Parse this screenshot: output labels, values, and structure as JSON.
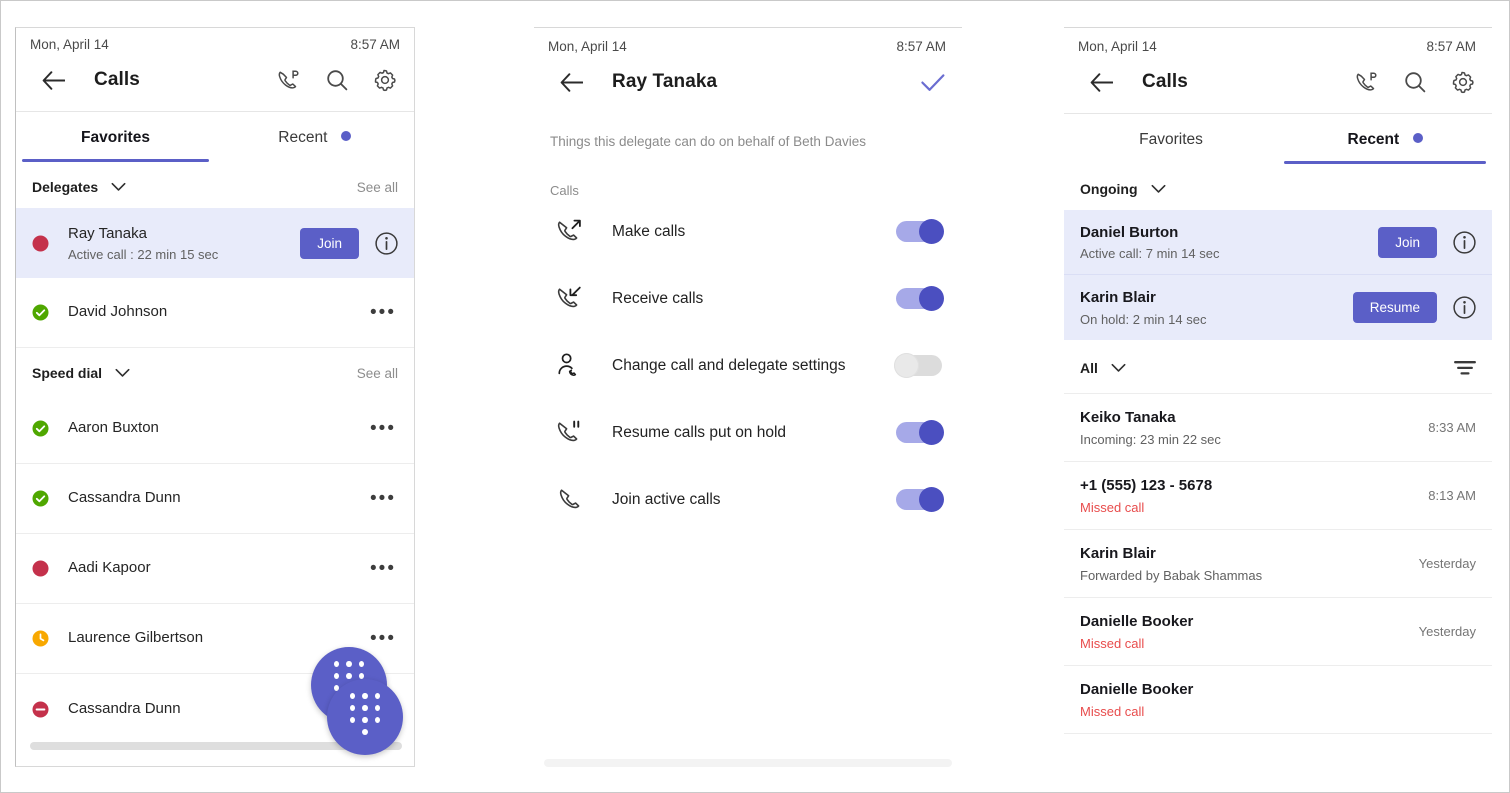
{
  "statusbar": {
    "date": "Mon, April 14",
    "time": "8:57 AM"
  },
  "panel1": {
    "appbar": {
      "title": "Calls"
    },
    "tabs": [
      {
        "label": "Favorites",
        "active": true,
        "dot": false
      },
      {
        "label": "Recent",
        "active": false,
        "dot": true
      }
    ],
    "delegates_section": {
      "title": "Delegates",
      "see_all": "See all"
    },
    "delegates": [
      {
        "name": "Ray Tanaka",
        "status": "Active call : 22 min 15 sec",
        "presence": "busy",
        "action": "Join",
        "highlight": true
      },
      {
        "name": "David Johnson",
        "status": "",
        "presence": "available",
        "action": "",
        "highlight": false
      }
    ],
    "speed_dial_section": {
      "title": "Speed dial",
      "see_all": "See all"
    },
    "speed_dial": [
      {
        "name": "Aaron Buxton",
        "presence": "available"
      },
      {
        "name": "Cassandra Dunn",
        "presence": "available"
      },
      {
        "name": "Aadi Kapoor",
        "presence": "busy"
      },
      {
        "name": "Laurence Gilbertson",
        "presence": "away"
      },
      {
        "name": "Cassandra Dunn",
        "presence": "dnd"
      }
    ]
  },
  "panel2": {
    "appbar": {
      "title": "Ray Tanaka"
    },
    "note": "Things this delegate can do on behalf of Beth Davies",
    "group_label": "Calls",
    "permissions": [
      {
        "label": "Make calls",
        "icon": "call-outgoing-icon",
        "on": true
      },
      {
        "label": "Receive calls",
        "icon": "call-incoming-icon",
        "on": true
      },
      {
        "label": "Change call and delegate settings",
        "icon": "person-call-icon",
        "on": false
      },
      {
        "label": "Resume calls put on hold",
        "icon": "call-pause-icon",
        "on": true
      },
      {
        "label": "Join active calls",
        "icon": "call-icon",
        "on": true
      }
    ]
  },
  "panel3": {
    "appbar": {
      "title": "Calls"
    },
    "tabs": [
      {
        "label": "Favorites",
        "active": false,
        "dot": false
      },
      {
        "label": "Recent",
        "active": true,
        "dot": true
      }
    ],
    "ongoing_section": {
      "title": "Ongoing"
    },
    "ongoing": [
      {
        "name": "Daniel Burton",
        "status": "Active call: 7 min 14 sec",
        "action": "Join"
      },
      {
        "name": "Karin Blair",
        "status": "On hold: 2 min 14 sec",
        "action": "Resume"
      }
    ],
    "filter": {
      "label": "All"
    },
    "history": [
      {
        "name": "Keiko Tanaka",
        "detail": "Incoming: 23 min 22 sec",
        "missed": false,
        "time": "8:33 AM"
      },
      {
        "name": "+1 (555) 123 - 5678",
        "detail": "Missed call",
        "missed": true,
        "time": "8:13 AM"
      },
      {
        "name": "Karin Blair",
        "detail": "Forwarded by Babak Shammas",
        "missed": false,
        "time": "Yesterday"
      },
      {
        "name": "Danielle Booker",
        "detail": "Missed call",
        "missed": true,
        "time": "Yesterday"
      },
      {
        "name": "Danielle Booker",
        "detail": "Missed call",
        "missed": true,
        "time": ""
      }
    ]
  },
  "colors": {
    "accent": "#5b5fc7",
    "highlight_bg": "#e8ebfa",
    "missed": "#e84c4c",
    "available": "#6bb700",
    "busy": "#c4314b",
    "away": "#f8a800",
    "dnd": "#c4314b"
  }
}
